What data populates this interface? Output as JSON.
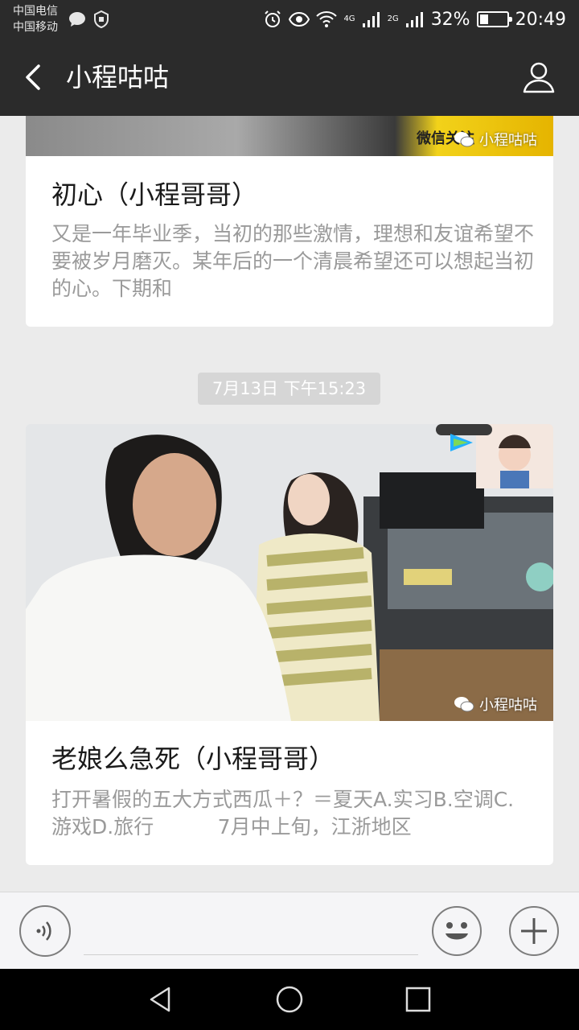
{
  "status_bar": {
    "carrier_1": "中国电信",
    "carrier_2": "中国移动",
    "network_1": "4G",
    "network_2": "2G",
    "battery": "32%",
    "battery_level": 0.32,
    "time": "20:49"
  },
  "header": {
    "title": "小程咕咕"
  },
  "messages": [
    {
      "title": "初心（小程哥哥）",
      "description": "又是一年毕业季，当初的那些激情，理想和友谊希望不要被岁月磨灭。某年后的一个清晨希望还可以想起当初的心。下期和",
      "cover_text": "微信关注",
      "watermark": "小程咕咕"
    },
    {
      "timestamp": "7月13日 下午15:23",
      "title": "老娘么急死（小程哥哥）",
      "description": "打开暑假的五大方式西瓜＋？＝夏天A.实习B.空调C.游戏D.旅行          7月中上旬，江浙地区",
      "watermark": "小程咕咕"
    }
  ],
  "input_bar": {
    "placeholder": ""
  },
  "colors": {
    "header_bg": "#2b2b2b",
    "page_bg": "#ebebeb",
    "card_bg": "#ffffff",
    "desc_text": "#9a9a9a"
  },
  "icons": [
    "chat-bubble-icon",
    "shield-icon",
    "alarm-icon",
    "eye-icon",
    "wifi-icon",
    "signal-icon",
    "battery-icon",
    "back-arrow-icon",
    "person-icon",
    "voice-icon",
    "emoji-icon",
    "plus-icon",
    "nav-back-icon",
    "nav-home-icon",
    "nav-recent-icon",
    "wechat-icon"
  ]
}
